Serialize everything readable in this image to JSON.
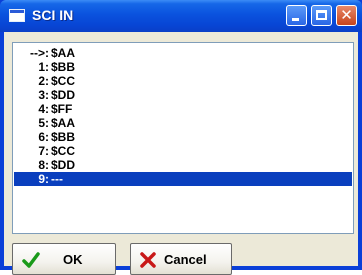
{
  "window": {
    "title": "SCI IN"
  },
  "list": {
    "rows": [
      {
        "index": "-->:",
        "value": "$AA"
      },
      {
        "index": "1:",
        "value": "$BB"
      },
      {
        "index": "2:",
        "value": "$CC"
      },
      {
        "index": "3:",
        "value": "$DD"
      },
      {
        "index": "4:",
        "value": "$FF"
      },
      {
        "index": "5:",
        "value": "$AA"
      },
      {
        "index": "6:",
        "value": "$BB"
      },
      {
        "index": "7:",
        "value": "$CC"
      },
      {
        "index": "8:",
        "value": "$DD"
      },
      {
        "index": "9:",
        "value": "---"
      }
    ],
    "selected_index": 9
  },
  "buttons": {
    "ok_label": "OK",
    "ok_icon": "checkmark-icon",
    "cancel_label": "Cancel",
    "cancel_icon": "x-icon"
  },
  "colors": {
    "selection": "#0a3fbe",
    "ok_icon": "#1a9a1a",
    "cancel_icon": "#c81818"
  }
}
